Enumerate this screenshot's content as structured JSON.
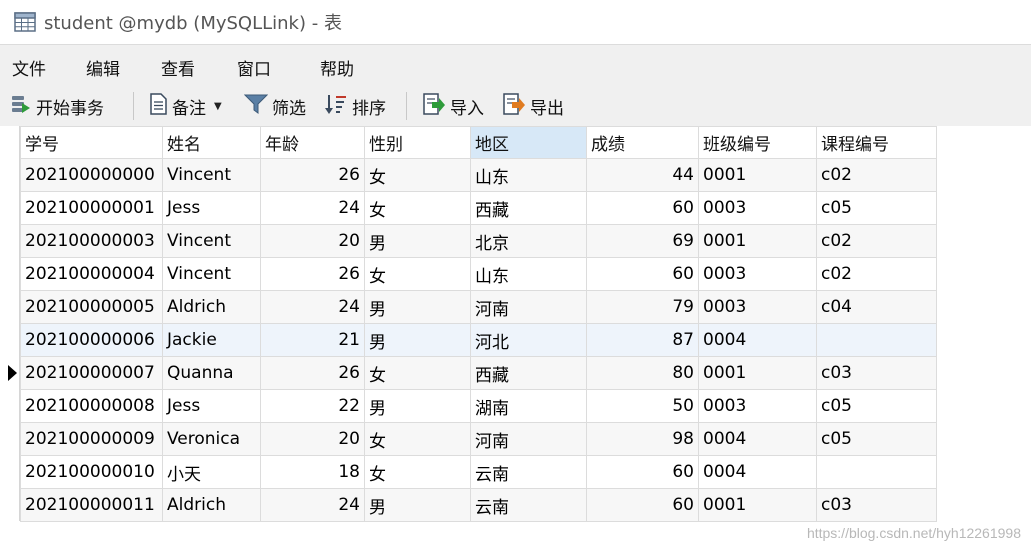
{
  "window": {
    "title": "student @mydb (MySQLLink) - 表",
    "icon": "table-grid-icon"
  },
  "menu": [
    {
      "label": "文件"
    },
    {
      "label": "编辑"
    },
    {
      "label": "查看"
    },
    {
      "label": "窗口"
    },
    {
      "label": "帮助"
    }
  ],
  "toolbar": {
    "begin_transaction": "开始事务",
    "memo": "备注",
    "filter": "筛选",
    "sort": "排序",
    "import": "导入",
    "export": "导出"
  },
  "grid": {
    "columns": [
      "学号",
      "姓名",
      "年龄",
      "性别",
      "地区",
      "成绩",
      "班级编号",
      "课程编号"
    ],
    "active_column": "地区",
    "current_row": 6,
    "rows": [
      [
        "202100000000",
        "Vincent",
        "26",
        "女",
        "山东",
        "44",
        "0001",
        "c02"
      ],
      [
        "202100000001",
        "Jess",
        "24",
        "女",
        "西藏",
        "60",
        "0003",
        "c05"
      ],
      [
        "202100000003",
        "Vincent",
        "20",
        "男",
        "北京",
        "69",
        "0001",
        "c02"
      ],
      [
        "202100000004",
        "Vincent",
        "26",
        "女",
        "山东",
        "60",
        "0003",
        "c02"
      ],
      [
        "202100000005",
        "Aldrich",
        "24",
        "男",
        "河南",
        "79",
        "0003",
        "c04"
      ],
      [
        "202100000006",
        "Jackie",
        "21",
        "男",
        "河北",
        "87",
        "0004",
        ""
      ],
      [
        "202100000007",
        "Quanna",
        "26",
        "女",
        "西藏",
        "80",
        "0001",
        "c03"
      ],
      [
        "202100000008",
        "Jess",
        "22",
        "男",
        "湖南",
        "50",
        "0003",
        "c05"
      ],
      [
        "202100000009",
        "Veronica",
        "20",
        "女",
        "河南",
        "98",
        "0004",
        "c05"
      ],
      [
        "202100000010",
        "小天",
        "18",
        "女",
        "云南",
        "60",
        "0004",
        ""
      ],
      [
        "202100000011",
        "Aldrich",
        "24",
        "男",
        "云南",
        "60",
        "0001",
        "c03"
      ]
    ]
  },
  "watermark": "https://blog.csdn.net/hyh12261998"
}
